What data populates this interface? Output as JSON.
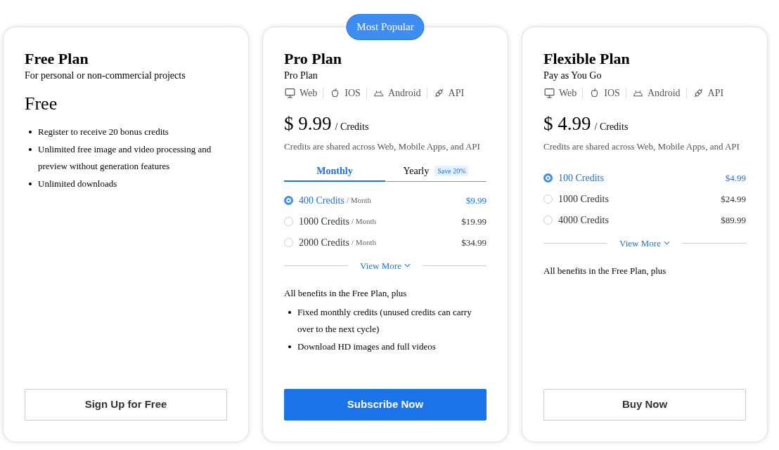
{
  "plans": [
    {
      "title": "Free Plan",
      "subtitle": "For personal or non-commercial projects",
      "price": {
        "amount": "Free"
      },
      "benefits": [
        "Register to receive 20 bonus credits",
        "Unlimited free image and video processing and preview without generation features",
        "Unlimited downloads"
      ],
      "button": {
        "label": "Sign Up for Free",
        "kind": "outline"
      }
    },
    {
      "badge": "Most Popular",
      "title": "Pro Plan",
      "subtitle": "Pro Plan",
      "platforms": [
        {
          "kind": "web",
          "label": "Web"
        },
        {
          "kind": "ios",
          "label": "IOS"
        },
        {
          "kind": "android",
          "label": "Android"
        },
        {
          "kind": "api",
          "label": "API"
        }
      ],
      "price": {
        "amount": "$ 9.99",
        "unit": "/ Credits"
      },
      "note": "Credits are shared across Web, Mobile Apps, and API",
      "tabs": [
        {
          "label": "Monthly",
          "selected": true
        },
        {
          "label": "Yearly",
          "selected": false,
          "tag": "Save 20%"
        }
      ],
      "options": [
        {
          "credits": "400 Credits",
          "period": "/ Month",
          "price": "$9.99",
          "selected": true
        },
        {
          "credits": "1000 Credits",
          "period": "/ Month",
          "price": "$19.99",
          "selected": false
        },
        {
          "credits": "2000 Credits",
          "period": "/ Month",
          "price": "$34.99",
          "selected": false
        }
      ],
      "view_more": "View More",
      "benefits_intro": "All benefits in the Free Plan, plus",
      "benefits": [
        "Fixed monthly credits (unused credits can carry over to the next cycle)",
        "Download HD images and full videos"
      ],
      "button": {
        "label": "Subscribe Now",
        "kind": "primary"
      }
    },
    {
      "title": "Flexible Plan",
      "subtitle": "Pay as You Go",
      "platforms": [
        {
          "kind": "web",
          "label": "Web"
        },
        {
          "kind": "ios",
          "label": "IOS"
        },
        {
          "kind": "android",
          "label": "Android"
        },
        {
          "kind": "api",
          "label": "API"
        }
      ],
      "price": {
        "amount": "$ 4.99",
        "unit": "/ Credits"
      },
      "note": "Credits are shared across Web, Mobile Apps, and API",
      "options": [
        {
          "credits": "100 Credits",
          "price": "$4.99",
          "selected": true
        },
        {
          "credits": "1000 Credits",
          "price": "$24.99",
          "selected": false
        },
        {
          "credits": "4000 Credits",
          "price": "$89.99",
          "selected": false
        }
      ],
      "view_more": "View More",
      "benefits_intro": "All benefits in the Free Plan, plus",
      "button": {
        "label": "Buy Now",
        "kind": "outline"
      }
    }
  ]
}
